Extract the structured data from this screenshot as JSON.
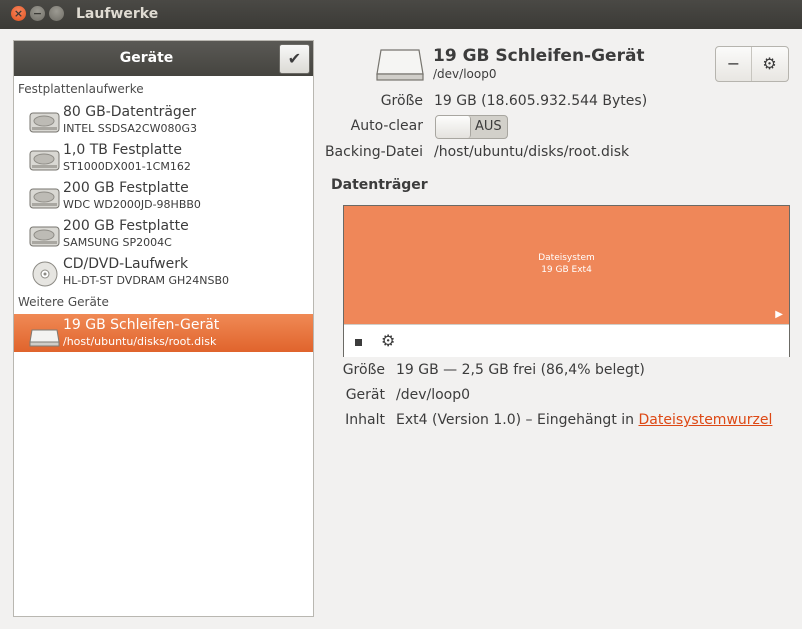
{
  "window": {
    "title": "Laufwerke"
  },
  "sidebar": {
    "header": "Geräte",
    "sections": [
      {
        "title": "Festplattenlaufwerke",
        "items": [
          {
            "name": "80 GB-Datenträger",
            "sub": "INTEL SSDSA2CW080G3",
            "icon": "harddisk-icon"
          },
          {
            "name": "1,0 TB Festplatte",
            "sub": "ST1000DX001-1CM162",
            "icon": "harddisk-icon"
          },
          {
            "name": "200 GB Festplatte",
            "sub": "WDC WD2000JD-98HBB0",
            "icon": "harddisk-icon"
          },
          {
            "name": "200 GB Festplatte",
            "sub": "SAMSUNG SP2004C",
            "icon": "harddisk-icon"
          },
          {
            "name": "CD/DVD-Laufwerk",
            "sub": "HL-DT-ST DVDRAM GH24NSB0",
            "icon": "optical-disc-icon"
          }
        ]
      },
      {
        "title": "Weitere Geräte",
        "items": [
          {
            "name": "19 GB Schleifen-Gerät",
            "sub": "/host/ubuntu/disks/root.disk",
            "icon": "loop-device-icon",
            "selected": true
          }
        ]
      }
    ]
  },
  "device": {
    "title": "19 GB Schleifen-Gerät",
    "path": "/dev/loop0",
    "size_label": "Größe",
    "size_value": "19 GB (18.605.932.544 Bytes)",
    "autoclear_label": "Auto-clear",
    "autoclear_state": "AUS",
    "backing_label": "Backing-Datei",
    "backing_value": "/host/ubuntu/disks/root.disk",
    "minus_label": "−",
    "gear_label": "⚙"
  },
  "volumes": {
    "title": "Datenträger",
    "partition_name": "Dateisystem",
    "partition_size": "19 GB Ext4",
    "partition_color": "#ef8759",
    "size_label": "Größe",
    "size_value": "19 GB — 2,5 GB frei (86,4% belegt)",
    "device_label": "Gerät",
    "device_value": "/dev/loop0",
    "content_label": "Inhalt",
    "content_value": "Ext4 (Version 1.0) – Eingehängt in ",
    "content_link": "Dateisystemwurzel"
  }
}
